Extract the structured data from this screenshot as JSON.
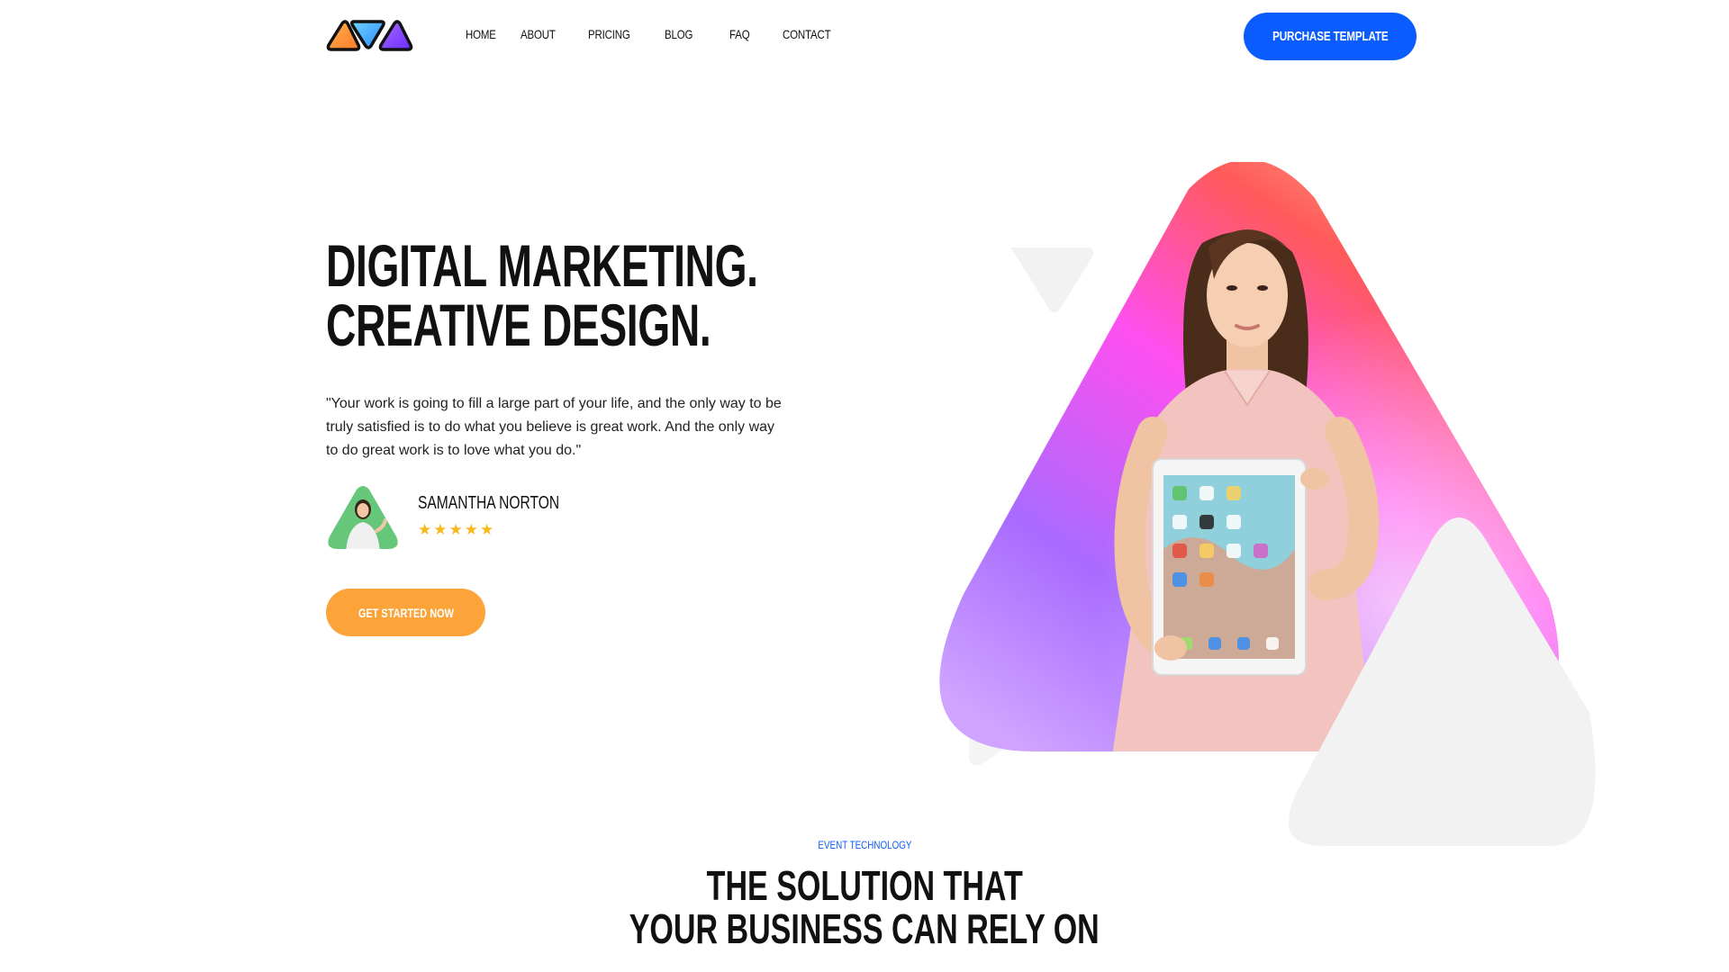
{
  "header": {
    "nav": [
      {
        "label": "HOME"
      },
      {
        "label": "ABOUT"
      },
      {
        "label": "PRICING"
      },
      {
        "label": "BLOG"
      },
      {
        "label": "FAQ"
      },
      {
        "label": "CONTACT"
      }
    ],
    "purchase_label": "PURCHASE TEMPLATE"
  },
  "hero": {
    "title_line1": "DIGITAL MARKETING.",
    "title_line2": "CREATIVE DESIGN.",
    "quote": "\"Your work is going to fill a large part of your life, and the only way to be truly satisfied is to do what you believe is great work. And the only way to do great work is to love what you do.\"",
    "author_name": "SAMANTHA NORTON",
    "rating": 5,
    "cta_label": "GET STARTED NOW"
  },
  "section": {
    "eyebrow": "EVENT TECHNOLOGY",
    "title_line1": "THE SOLUTION THAT",
    "title_line2": "YOUR BUSINESS CAN RELY ON"
  },
  "colors": {
    "primary_blue": "#0a5cff",
    "cta_orange": "#fca43a",
    "star_yellow": "#f9b81b",
    "avatar_green": "#66c67a"
  },
  "icons": {
    "logo": "triangles-logo-icon",
    "star": "star-icon"
  }
}
